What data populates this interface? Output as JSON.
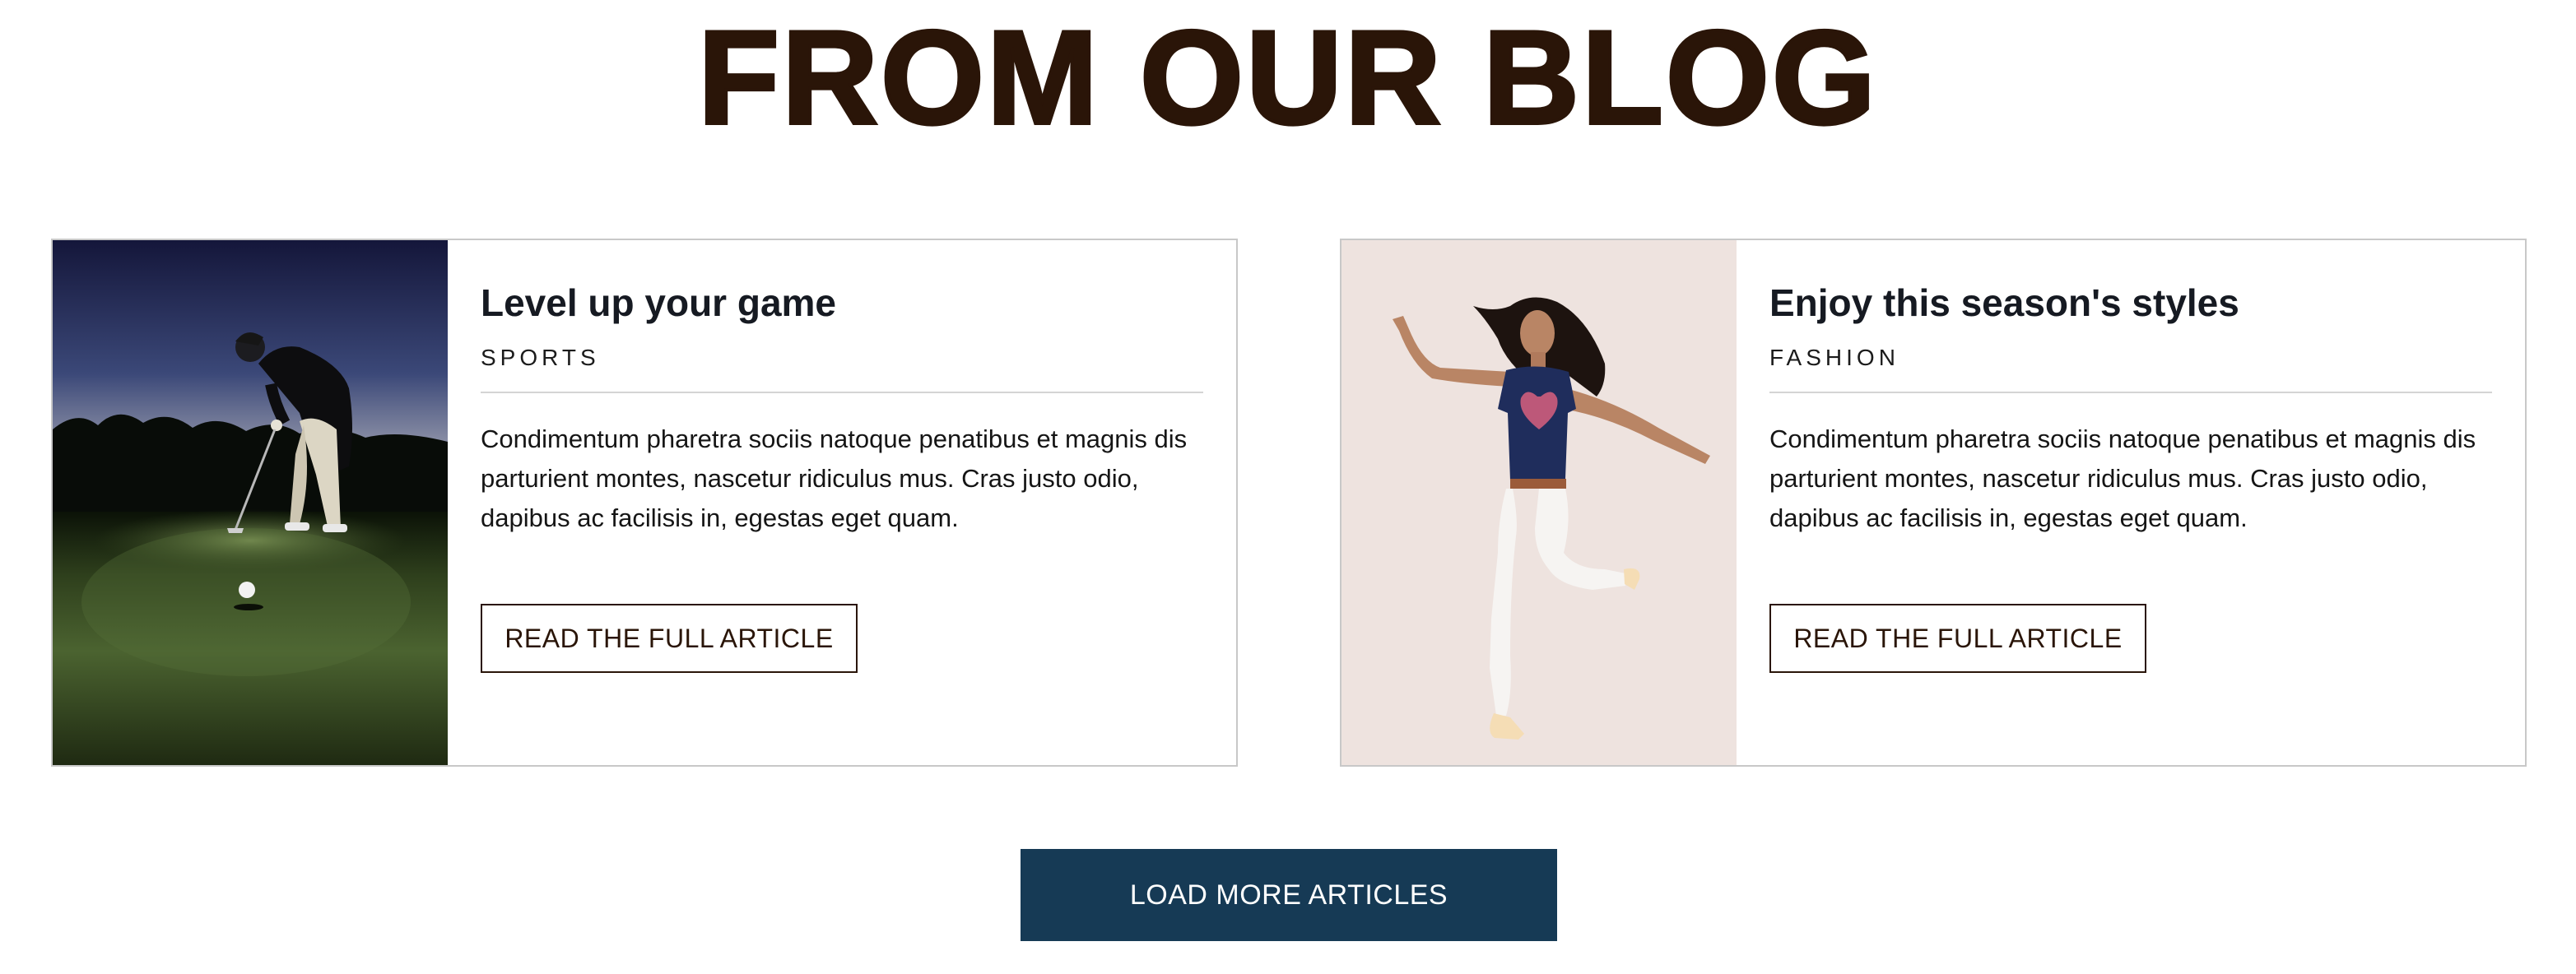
{
  "blog": {
    "heading": "FROM OUR BLOG",
    "articles": [
      {
        "title": "Level up your game",
        "category": "SPORTS",
        "excerpt": "Condimentum pharetra sociis natoque penatibus et magnis dis parturient montes, nascetur ridiculus mus. Cras justo odio, dapibus ac facilisis in, egestas eget quam.",
        "button_label": "READ THE FULL ARTICLE"
      },
      {
        "title": "Enjoy this season's styles",
        "category": "FASHION",
        "excerpt": "Condimentum pharetra sociis natoque penatibus et magnis dis parturient montes, nascetur ridiculus mus. Cras justo odio, dapibus ac facilisis in, egestas eget quam.",
        "button_label": "READ THE FULL ARTICLE"
      }
    ],
    "load_more_label": "LOAD MORE ARTICLES"
  },
  "colors": {
    "heading": "#2a1508",
    "load_more_background": "#163a55",
    "card_border": "#c8c8c8"
  }
}
